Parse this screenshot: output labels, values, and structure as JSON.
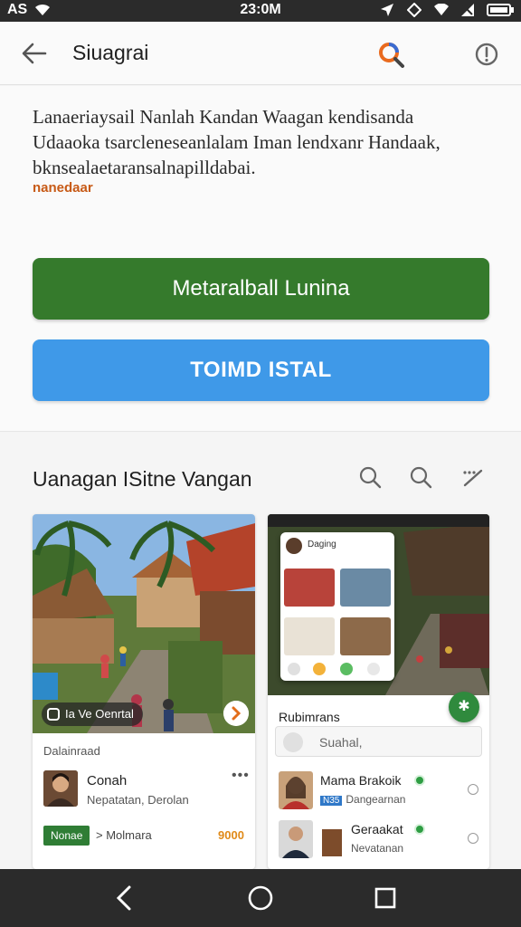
{
  "status_bar": {
    "carrier": "AS",
    "time": "23:0M"
  },
  "app_bar": {
    "title": "Siuagrai"
  },
  "description": {
    "line1": "Lanaeriaysail Nanlah Kandan Waagan kendisanda",
    "line2": "Udaaoka tsarcleneseanlalam Iman lendxanr Handaak,",
    "line3": "bknsealaetaransalnapilldabai.",
    "tag": "nanedaar"
  },
  "buttons": {
    "primary": "Metaralball Lunina",
    "secondary": "TOIMD ISTAL"
  },
  "gallery": {
    "heading": "Uanagan ISitne Vangan",
    "left_card": {
      "chip": "Ia Ve Oenrtal",
      "label": "Dalainraad",
      "name": "Conah",
      "subtitle": "Nepatatan, Derolan",
      "more": "•••",
      "badge": "Nonae",
      "middle": "> Molmara",
      "price": "9000"
    },
    "right_card": {
      "popup_title": "Daging",
      "sheet_title": "Rubimrans",
      "search_placeholder": "Suahal,",
      "fab_icon": "✱",
      "rows": [
        {
          "name": "Mama Brakoik",
          "tag": "N35",
          "sub": "Dangearnan"
        },
        {
          "name": "Geraakat",
          "tag": "",
          "sub": "Nevatanan"
        }
      ]
    }
  },
  "colors": {
    "primary_button": "#357a2c",
    "secondary_button": "#3f99e8",
    "online": "#2e9d43",
    "price": "#e08a19"
  }
}
